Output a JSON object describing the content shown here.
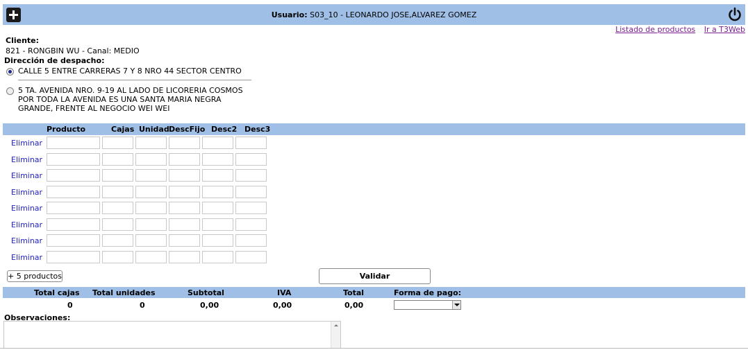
{
  "header": {
    "user_prefix": "Usuario:",
    "user_value": "S03_10 - LEONARDO JOSE,ALVAREZ GOMEZ",
    "add_icon": "plus-icon",
    "power_icon": "power-icon",
    "bar_color": "#9fbfe6"
  },
  "links": {
    "listado": "Listado de productos",
    "t3web": "Ir a T3Web"
  },
  "cliente": {
    "label": "Cliente:",
    "value": "821 - RONGBIN WU - Canal: MEDIO"
  },
  "despacho": {
    "label": "Dirección de despacho:",
    "options": [
      {
        "text": "CALLE 5 ENTRE CARRERAS 7 Y 8 NRO 44 SECTOR CENTRO",
        "checked": true
      },
      {
        "text": "5 TA. AVENIDA NRO. 9-19 AL LADO DE LICORERIA COSMOS POR TODA LA AVENIDA ES UNA SANTA MARIA NEGRA GRANDE, FRENTE AL NEGOCIO WEI WEI",
        "checked": false
      }
    ]
  },
  "productos": {
    "headers": [
      "Producto",
      "Cajas",
      "Unidad",
      "DescFijo",
      "Desc2",
      "Desc3"
    ],
    "remove_label": "Eliminar",
    "row_count": 8,
    "more_button": "+ 5 productos",
    "validate_button": "Validar"
  },
  "totales": {
    "headers": {
      "total_cajas": "Total cajas",
      "total_unidades": "Total unidades",
      "subtotal": "Subtotal",
      "iva": "IVA",
      "total": "Total",
      "forma_pago": "Forma de pago:"
    },
    "values": {
      "total_cajas": "0",
      "total_unidades": "0",
      "subtotal": "0,00",
      "iva": "0,00",
      "total": "0,00"
    },
    "forma_pago_selected": ""
  },
  "observaciones": {
    "label": "Observaciones:",
    "value": ""
  }
}
